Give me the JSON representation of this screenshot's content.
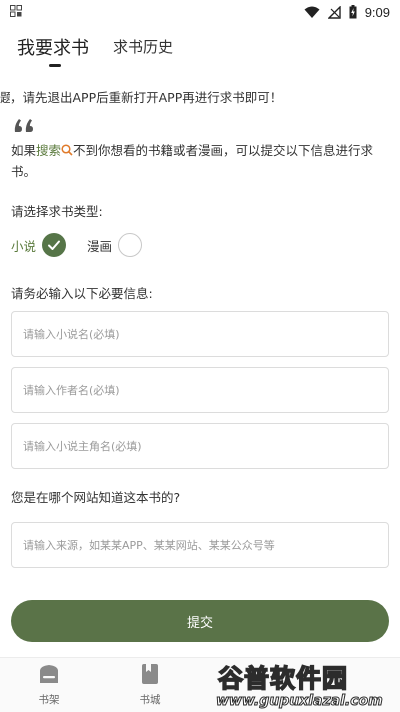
{
  "status_bar": {
    "time": "9:09",
    "icons": [
      "wifi-icon",
      "signal-icon",
      "battery-charging-icon"
    ],
    "left_icon": "app-grid-icon"
  },
  "tabs": [
    {
      "label": "我要求书",
      "active": true
    },
    {
      "label": "求书历史",
      "active": false
    }
  ],
  "notice": {
    "clipped_lead": "题",
    "text": "，请先退出APP后重新打开APP再进行求书即可！"
  },
  "intro": {
    "prefix": "如果",
    "search_word": "搜索",
    "suffix": "不到你想看的书籍或者漫画，可以提交以下信息进行求书。"
  },
  "type_section": {
    "label": "请选择求书类型:",
    "options": [
      {
        "label": "小说",
        "selected": true
      },
      {
        "label": "漫画",
        "selected": false
      }
    ]
  },
  "required_section": {
    "label": "请务必输入以下必要信息:",
    "fields": [
      {
        "placeholder": "请输入小说名(必填)",
        "value": ""
      },
      {
        "placeholder": "请输入作者名(必填)",
        "value": ""
      },
      {
        "placeholder": "请输入小说主角名(必填)",
        "value": ""
      }
    ]
  },
  "source_section": {
    "label": "您是在哪个网站知道这本书的?",
    "field": {
      "placeholder": "请输入来源，如某某APP、某某网站、某某公众号等",
      "value": ""
    }
  },
  "submit_label": "提交",
  "bottom_nav": [
    {
      "label": "书架",
      "icon": "bookshelf-icon"
    },
    {
      "label": "书城",
      "icon": "book-icon"
    }
  ],
  "watermark": {
    "main": "谷普软件园",
    "url": "www.gupuxlazal.com"
  },
  "colors": {
    "accent": "#567548",
    "accent_text": "#5a7a3c",
    "button": "#5a7348"
  }
}
